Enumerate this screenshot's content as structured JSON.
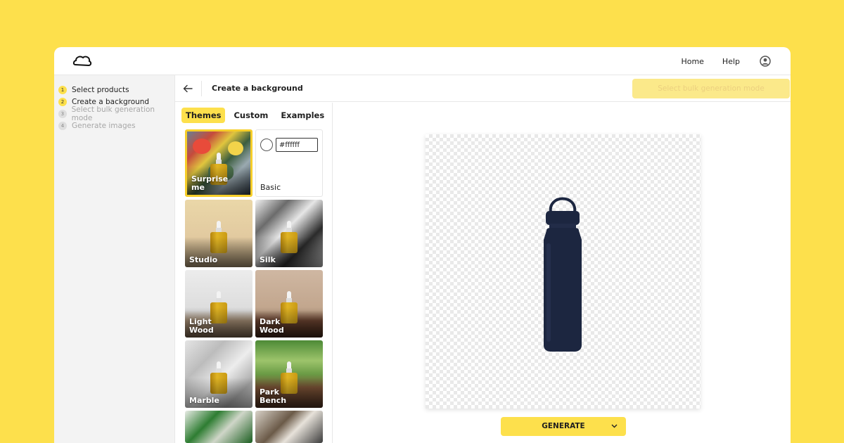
{
  "topbar": {
    "nav": [
      "Home",
      "Help"
    ],
    "user_icon": "user-circle-icon"
  },
  "steps": [
    {
      "num": "1",
      "label": "Select products",
      "state": "done"
    },
    {
      "num": "2",
      "label": "Create a background",
      "state": "done"
    },
    {
      "num": "3",
      "label": "Select bulk generation mode",
      "state": "todo"
    },
    {
      "num": "4",
      "label": "Generate images",
      "state": "todo"
    }
  ],
  "header": {
    "title": "Create a background",
    "bulk_button": "Select bulk generation mode"
  },
  "tabs": [
    "Themes",
    "Custom",
    "Examples"
  ],
  "themes": {
    "surprise": "Surprise me",
    "basic": "Basic",
    "basic_color": "#ffffff",
    "studio": "Studio",
    "silk": "Silk",
    "light_wood": "Light Wood",
    "dark_wood": "Dark Wood",
    "marble": "Marble",
    "park_bench": "Park Bench"
  },
  "generate_button": "GENERATE",
  "colors": {
    "accent": "#fde04c",
    "product": "#1c2640"
  }
}
